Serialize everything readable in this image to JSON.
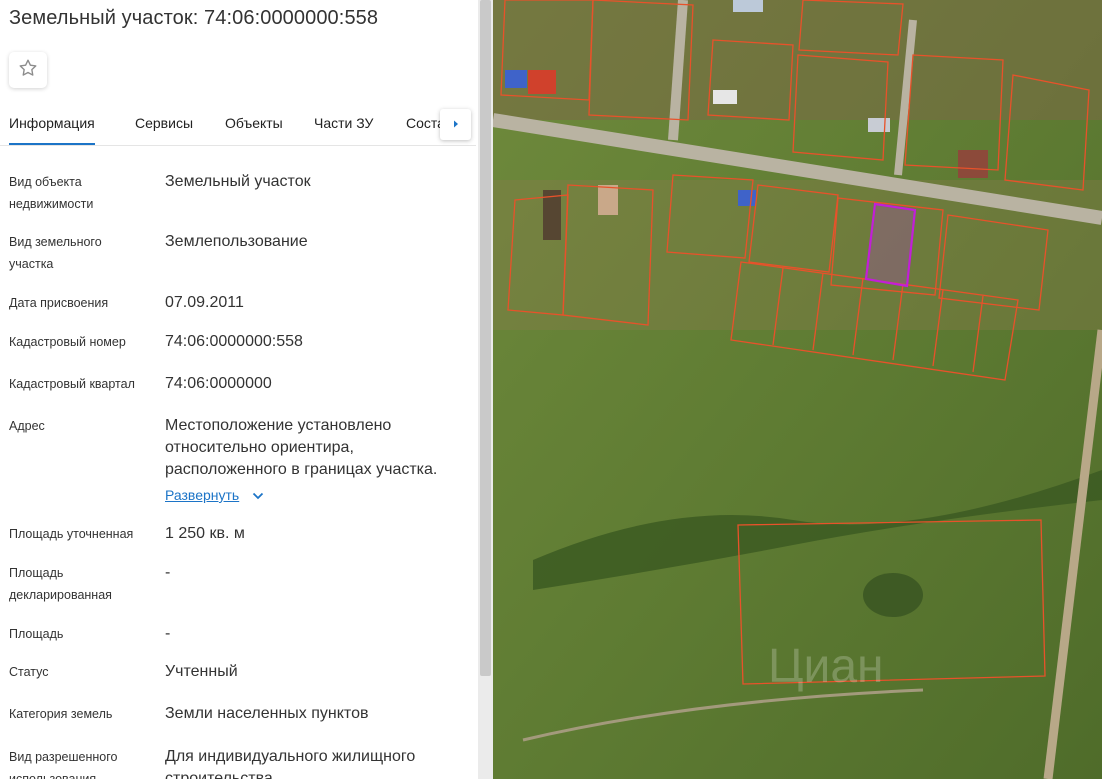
{
  "header": {
    "title": "Земельный участок: 74:06:0000000:558"
  },
  "tabs": [
    {
      "label": "Информация"
    },
    {
      "label": "Сервисы"
    },
    {
      "label": "Объекты"
    },
    {
      "label": "Части ЗУ"
    },
    {
      "label": "Состав"
    }
  ],
  "fields": [
    {
      "label": "Вид объекта недвижимости",
      "value": "Земельный участок"
    },
    {
      "label": "Вид земельного участка",
      "value": "Землепользование"
    },
    {
      "label": "Дата присвоения",
      "value": "07.09.2011"
    },
    {
      "label": "Кадастровый номер",
      "value": "74:06:0000000:558"
    },
    {
      "label": "Кадастровый квартал",
      "value": "74:06:0000000"
    },
    {
      "label": "Адрес",
      "value": "Местоположение установлено относительно ориентира, расположенного в границах участка.",
      "action": "Развернуть"
    },
    {
      "label": "Площадь уточненная",
      "value": "1 250 кв. м"
    },
    {
      "label": "Площадь декларированная",
      "value": "-"
    },
    {
      "label": "Площадь",
      "value": "-"
    },
    {
      "label": "Статус",
      "value": "Учтенный"
    },
    {
      "label": "Категория земель",
      "value": "Земли населенных пунктов"
    },
    {
      "label": "Вид разрешенного использования",
      "value": "Для индивидуального жилищного строительства"
    }
  ],
  "map": {
    "watermark": "Циан",
    "colors": {
      "parcel_border": "#e8522a",
      "selected_parcel": "#c21ed8",
      "link": "#1c74c7"
    }
  },
  "icons": {
    "favorite": "star-outline-icon",
    "tabs_next": "caret-right-icon",
    "expand": "chevron-down-icon"
  }
}
